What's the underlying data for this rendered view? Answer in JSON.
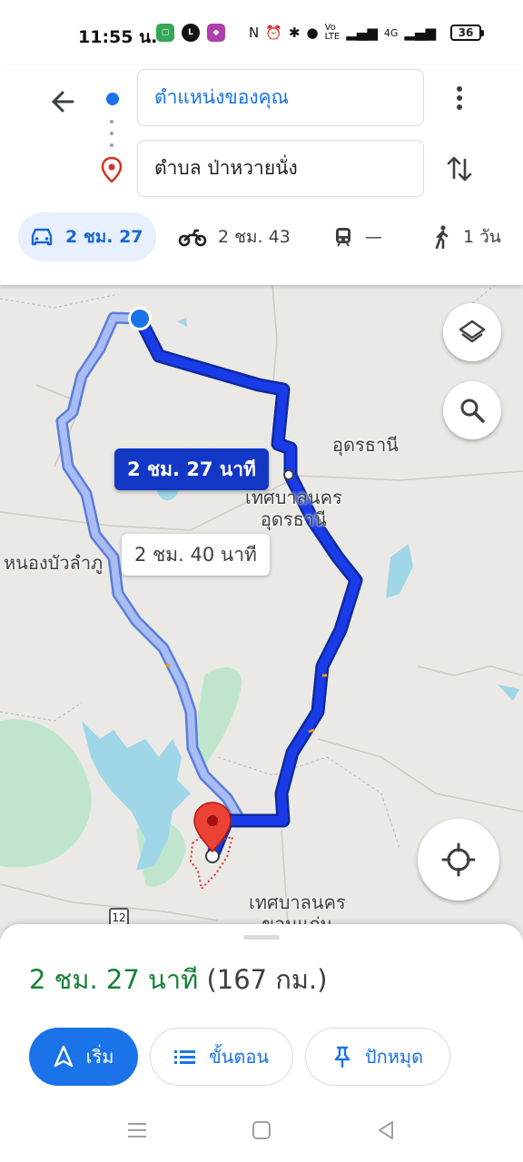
{
  "status_bar": {
    "time": "11:55 น.",
    "battery": "36",
    "network": "4G"
  },
  "directions": {
    "origin": "ตำแหน่งของคุณ",
    "destination": "ตำบล ป่าหวายนั่ง",
    "modes": [
      {
        "icon": "car-icon",
        "label": "2 ชม. 27",
        "active": true
      },
      {
        "icon": "motorcycle-icon",
        "label": "2 ชม. 43",
        "active": false
      },
      {
        "icon": "train-icon",
        "label": "—",
        "active": false
      },
      {
        "icon": "walk-icon",
        "label": "1 วัน",
        "active": false
      }
    ]
  },
  "map": {
    "labels": {
      "udon_thani": "อุดรธานี",
      "udon_municipality": "เทศบาลนคร\nอุดรธานี",
      "nong_bua_lamphu": "หนองบัวลำภู",
      "khon_kaen_municipality": "เทศบาลนคร\nขอนแก่น"
    },
    "route_main_label": "2 ชม. 27 นาที",
    "route_alt_label": "2 ชม. 40 นาที",
    "highway_badge": "12",
    "colors": {
      "route_main": "#1a3ce8",
      "route_alt": "#8ea6f0",
      "water": "#9fd6e8",
      "park": "#bfe6cd",
      "land": "#ebe9e6"
    }
  },
  "summary": {
    "duration": "2 ชม. 27 นาที",
    "distance": "(167 กม.)"
  },
  "actions": {
    "start": "เริ่ม",
    "steps": "ขั้นตอน",
    "pin": "ปักหมุด"
  }
}
